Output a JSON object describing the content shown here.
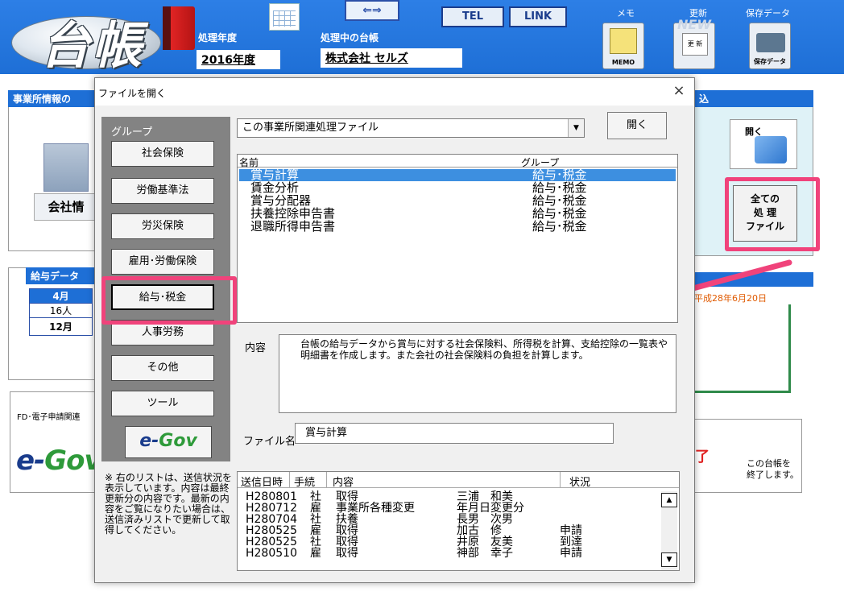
{
  "header": {
    "logo_text": "台帳",
    "fiscal_year_label": "処理年度",
    "fiscal_year_value": "2016年度",
    "ledger_label": "処理中の台帳",
    "ledger_value": "株式会社 セルズ",
    "arrow_label": "⇐⇒",
    "tel_label": "TEL",
    "link_label": "LINK",
    "memo_label": "メモ",
    "update_label": "更新",
    "save_label": "保存データ",
    "memo_icon_caption": "MEMO",
    "new_icon_caption": "NEW",
    "update_icon_caption": "更 新",
    "save_icon_caption": "保存データ"
  },
  "background": {
    "office_info_title": "事業所情報の",
    "company_info_label": "会社情",
    "salary_data_title": "給与データ",
    "salary_table": [
      [
        "4月",
        ""
      ],
      [
        "16人",
        ""
      ],
      [
        "12月",
        ""
      ]
    ],
    "open_icon_label": "開く",
    "all_files_button": [
      "全ての",
      "処 理",
      "ファイル"
    ],
    "right_title_partial": "込",
    "date_text": "平成28年6月20日",
    "fd_label": "FD･電子申請関連",
    "exit_text_red": "了",
    "exit_caption": [
      "この台帳を",
      "終了します。"
    ],
    "egov_e": "e-",
    "egov_gov": "Gov"
  },
  "dialog": {
    "title": "ファイルを開く",
    "close_glyph": "×",
    "group_label": "グループ",
    "groups": [
      {
        "label": "社会保険",
        "selected": false
      },
      {
        "label": "労働基準法",
        "selected": false
      },
      {
        "label": "労災保険",
        "selected": false
      },
      {
        "label": "雇用･労働保険",
        "selected": false
      },
      {
        "label": "給与･税金",
        "selected": true
      },
      {
        "label": "人事労務",
        "selected": false
      },
      {
        "label": "その他",
        "selected": false
      },
      {
        "label": "ツール",
        "selected": false
      }
    ],
    "egov_button_e": "e-",
    "egov_button_gov": "Gov",
    "note": "※ 右のリストは、送信状況を表示しています。内容は最終更新分の内容です。最新の内容をご覧になりたい場合は、送信済みリストで更新して取得してください。",
    "combo_value": "この事業所関連処理ファイル",
    "open_button": "開く",
    "list_columns": [
      "名前",
      "グループ"
    ],
    "files": [
      {
        "name": "賞与計算",
        "group": "給与･税金",
        "selected": true
      },
      {
        "name": "賃金分析",
        "group": "給与･税金",
        "selected": false
      },
      {
        "name": "賞与分配器",
        "group": "給与･税金",
        "selected": false
      },
      {
        "name": "扶養控除申告書",
        "group": "給与･税金",
        "selected": false
      },
      {
        "name": "退職所得申告書",
        "group": "給与･税金",
        "selected": false
      }
    ],
    "content_label": "内容",
    "content_text": "台帳の給与データから賞与に対する社会保険料、所得税を計算、支給控除の一覧表や明細書を作成します。また会社の社会保険料の負担を計算します。",
    "filename_label": "ファイル名",
    "filename_value": "賞与計算",
    "send_columns": [
      "送信日時",
      "手続",
      "内容",
      "状況"
    ],
    "send_rows": [
      {
        "date": "H280801",
        "proc": "社",
        "content": "取得",
        "person": "三浦　和美",
        "status": ""
      },
      {
        "date": "H280712",
        "proc": "雇",
        "content": "事業所各種変更",
        "person": "年月日変更分",
        "status": ""
      },
      {
        "date": "H280704",
        "proc": "社",
        "content": "扶養",
        "person": "長男　次男",
        "status": ""
      },
      {
        "date": "H280525",
        "proc": "雇",
        "content": "取得",
        "person": "加古　修",
        "status": "申請"
      },
      {
        "date": "H280525",
        "proc": "社",
        "content": "取得",
        "person": "井原　友美",
        "status": "到達"
      },
      {
        "date": "H280510",
        "proc": "雇",
        "content": "取得",
        "person": "神部　幸子",
        "status": "申請"
      }
    ]
  },
  "colors": {
    "header_blue": "#1e6fd6",
    "highlight_pink": "#f0437b",
    "selection_blue": "#3d8fe0"
  }
}
